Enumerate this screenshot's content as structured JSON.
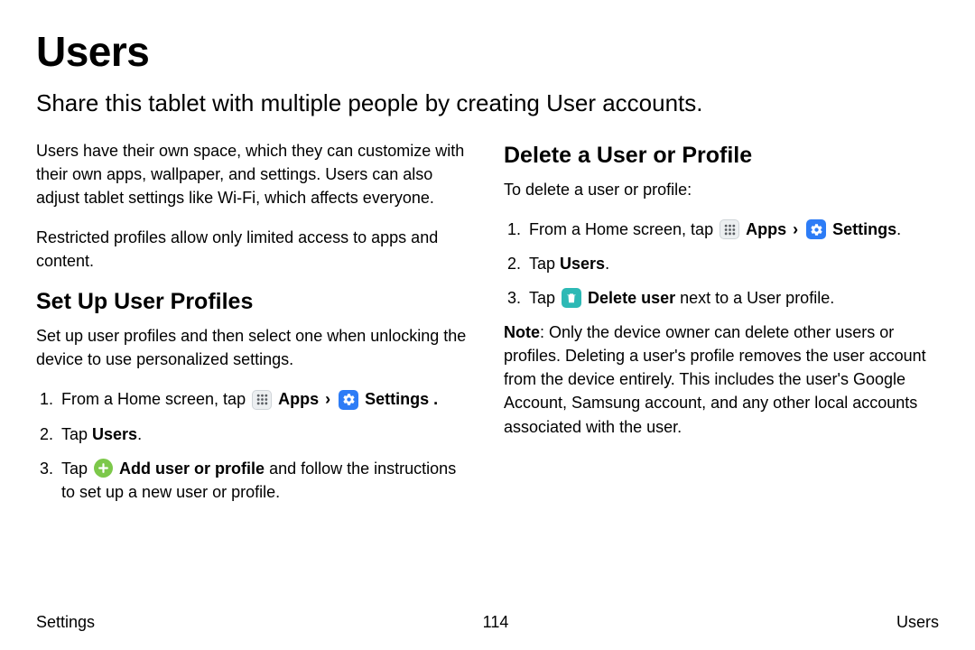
{
  "title": "Users",
  "lead": "Share this tablet with multiple people by creating User accounts.",
  "left": {
    "p1": "Users have their own space, which they can customize with their own apps, wallpaper, and settings. Users can also adjust tablet settings like Wi-Fi, which affects everyone.",
    "p2": "Restricted profiles allow only limited access to apps and content.",
    "h2": "Set Up User Profiles",
    "p3": "Set up user profiles and then select one when unlocking the device to use personalized settings.",
    "step1_a": "From a Home screen, tap ",
    "apps_label": "Apps",
    "settings_label": "Settings",
    "period": ".",
    "step2_a": "Tap ",
    "users_label": "Users",
    "step3_a": "Tap ",
    "add_label": "Add user or profile",
    "step3_b": "  and follow the instructions to set up a new user or profile."
  },
  "right": {
    "h2": "Delete a User or Profile",
    "p1": "To delete a user or profile:",
    "step1_a": "From a Home screen, tap ",
    "apps_label": "Apps",
    "settings_label": "Settings",
    "step2_a": "Tap ",
    "users_label": "Users",
    "step3_a": "Tap ",
    "delete_label": "Delete user",
    "step3_b": " next to a User profile.",
    "note_label": "Note",
    "note_body": ": Only the device owner can delete other users or profiles. Deleting a user's profile removes the user account from the device entirely. This includes the user's Google Account, Samsung account, and any other local accounts associated with the user."
  },
  "footer": {
    "left": "Settings",
    "center": "114",
    "right": "Users"
  }
}
